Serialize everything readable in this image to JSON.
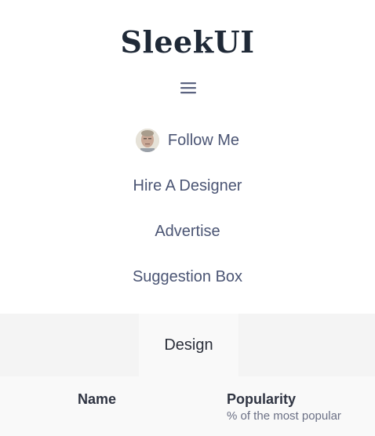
{
  "header": {
    "logo_text": "SleekUI",
    "menu_icon": "hamburger-menu-icon"
  },
  "nav": {
    "items": [
      {
        "label": "Follow Me",
        "icon": "avatar"
      },
      {
        "label": "Hire A Designer"
      },
      {
        "label": "Advertise"
      },
      {
        "label": "Suggestion Box"
      }
    ]
  },
  "tabs": [
    {
      "label": "Design",
      "active": true
    }
  ],
  "table": {
    "columns": [
      {
        "label": "Name"
      },
      {
        "label": "Popularity",
        "sublabel": "% of the most popular"
      }
    ]
  },
  "colors": {
    "logo": "#1f2937",
    "nav_text": "#4b5574",
    "tabs_background": "#f4f4f4",
    "active_tab_background": "#f9f9f9"
  }
}
